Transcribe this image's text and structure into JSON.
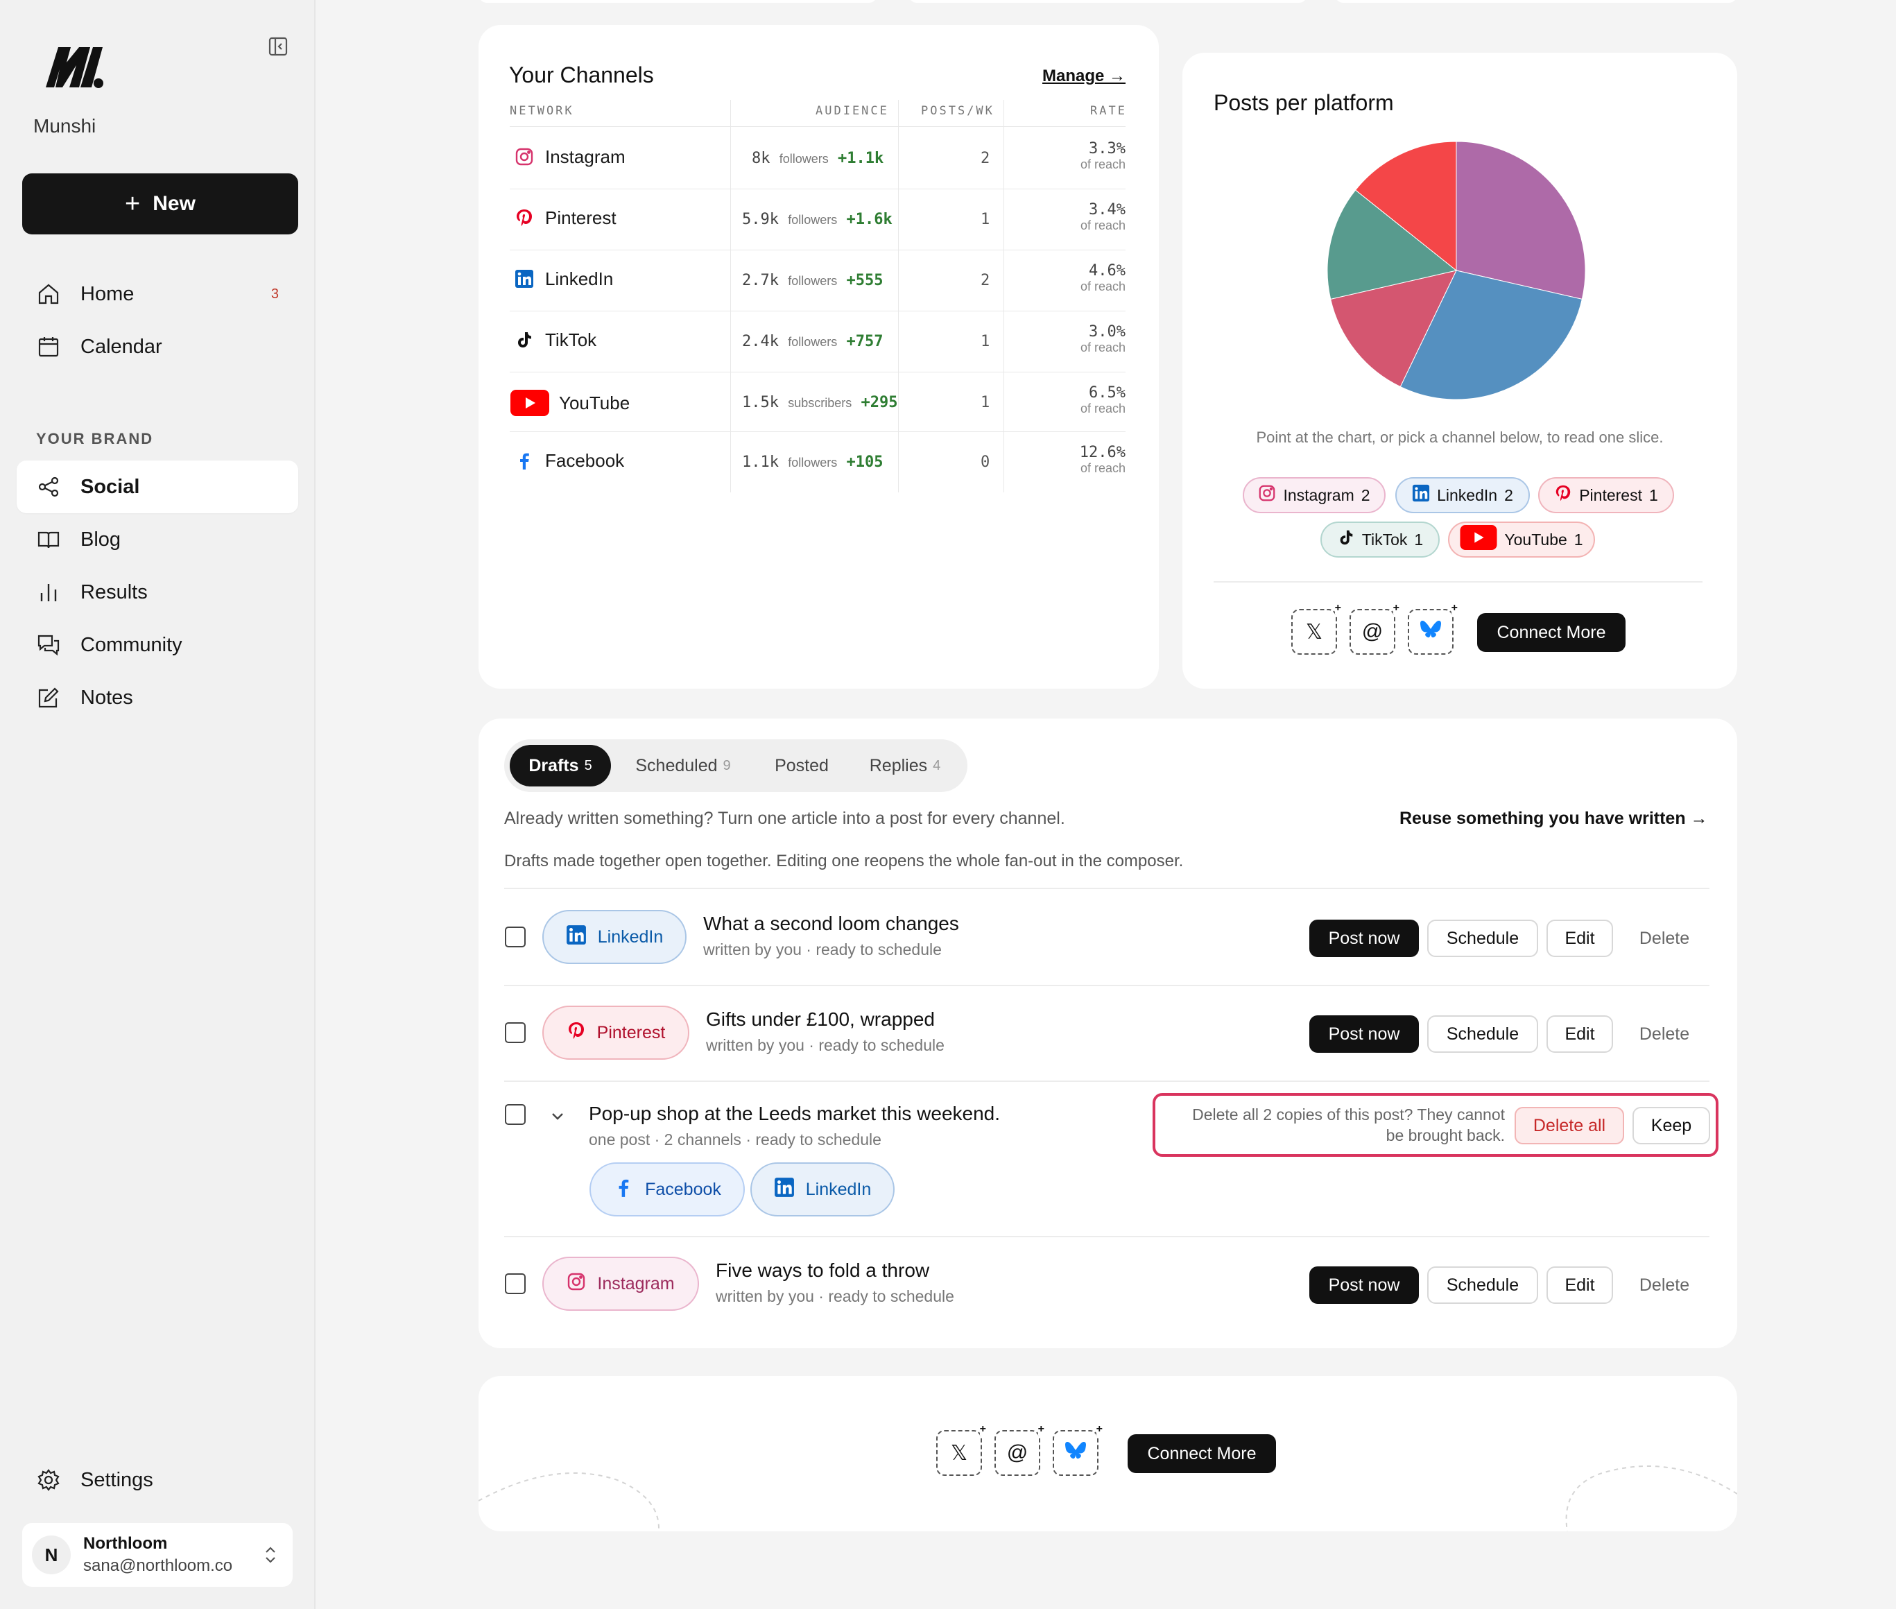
{
  "brand": {
    "name": "Munshi"
  },
  "sidebar": {
    "new_label": "New",
    "nav": [
      {
        "label": "Home",
        "badge": "3"
      },
      {
        "label": "Calendar"
      }
    ],
    "section_label": "YOUR BRAND",
    "brand_nav": [
      {
        "label": "Social",
        "active": true
      },
      {
        "label": "Blog"
      },
      {
        "label": "Results"
      },
      {
        "label": "Community"
      },
      {
        "label": "Notes"
      }
    ],
    "settings_label": "Settings",
    "account": {
      "initial": "N",
      "name": "Northloom",
      "email": "sana@northloom.co"
    }
  },
  "channels": {
    "title": "Your Channels",
    "manage_label": "Manage →",
    "headers": {
      "network": "NETWORK",
      "audience": "AUDIENCE",
      "posts": "POSTS/WK",
      "rate": "RATE"
    },
    "rows": [
      {
        "name": "Instagram",
        "count": "8k",
        "unit": "followers",
        "growth": "+1.1k",
        "posts": "2",
        "rate": "3.3%",
        "rate_sub": "of reach"
      },
      {
        "name": "Pinterest",
        "count": "5.9k",
        "unit": "followers",
        "growth": "+1.6k",
        "posts": "1",
        "rate": "3.4%",
        "rate_sub": "of reach"
      },
      {
        "name": "LinkedIn",
        "count": "2.7k",
        "unit": "followers",
        "growth": "+555",
        "posts": "2",
        "rate": "4.6%",
        "rate_sub": "of reach"
      },
      {
        "name": "TikTok",
        "count": "2.4k",
        "unit": "followers",
        "growth": "+757",
        "posts": "1",
        "rate": "3.0%",
        "rate_sub": "of reach"
      },
      {
        "name": "YouTube",
        "count": "1.5k",
        "unit": "subscribers",
        "growth": "+295",
        "posts": "1",
        "rate": "6.5%",
        "rate_sub": "of reach"
      },
      {
        "name": "Facebook",
        "count": "1.1k",
        "unit": "followers",
        "growth": "+105",
        "posts": "0",
        "rate": "12.6%",
        "rate_sub": "of reach"
      }
    ]
  },
  "posts_chart": {
    "title": "Posts per platform",
    "hint": "Point at the chart, or pick a channel below, to read one slice.",
    "legend": [
      {
        "name": "Instagram",
        "value": "2"
      },
      {
        "name": "LinkedIn",
        "value": "2"
      },
      {
        "name": "Pinterest",
        "value": "1"
      },
      {
        "name": "TikTok",
        "value": "1"
      },
      {
        "name": "YouTube",
        "value": "1"
      }
    ],
    "connect_label": "Connect More"
  },
  "chart_data": {
    "type": "pie",
    "title": "Posts per platform",
    "categories": [
      "Instagram",
      "LinkedIn",
      "Pinterest",
      "TikTok",
      "YouTube"
    ],
    "values": [
      2,
      2,
      1,
      1,
      1
    ],
    "colors": [
      "#ae6aa8",
      "#5590c0",
      "#d45670",
      "#589b8e",
      "#f44648"
    ]
  },
  "tabs": [
    {
      "label": "Drafts",
      "count": "5",
      "active": true
    },
    {
      "label": "Scheduled",
      "count": "9"
    },
    {
      "label": "Posted",
      "count": ""
    },
    {
      "label": "Replies",
      "count": "4"
    }
  ],
  "drafts": {
    "reuse_text": "Already written something? Turn one article into a post for every channel.",
    "reuse_link": "Reuse something you have written →",
    "note": "Drafts made together open together. Editing one reopens the whole fan-out in the composer.",
    "actions": {
      "post_now": "Post now",
      "schedule": "Schedule",
      "edit": "Edit",
      "delete": "Delete"
    },
    "items": [
      {
        "channel": "LinkedIn",
        "title": "What a second loom changes",
        "subtitle": "written by you · ready to schedule"
      },
      {
        "channel": "Pinterest",
        "title": "Gifts under £100, wrapped",
        "subtitle": "written by you · ready to schedule"
      },
      {
        "title": "Pop-up shop at the Leeds market this weekend.",
        "subtitle": "one post · 2 channels · ready to schedule",
        "channels": [
          "Facebook",
          "LinkedIn"
        ]
      },
      {
        "channel": "Instagram",
        "title": "Five ways to fold a throw",
        "subtitle": "written by you · ready to schedule"
      }
    ],
    "confirm": {
      "text_line1": "Delete all 2 copies of this post? They cannot",
      "text_line2": "be brought back.",
      "delete_all": "Delete all",
      "keep": "Keep"
    }
  },
  "footer_connect": {
    "label": "Connect More"
  }
}
